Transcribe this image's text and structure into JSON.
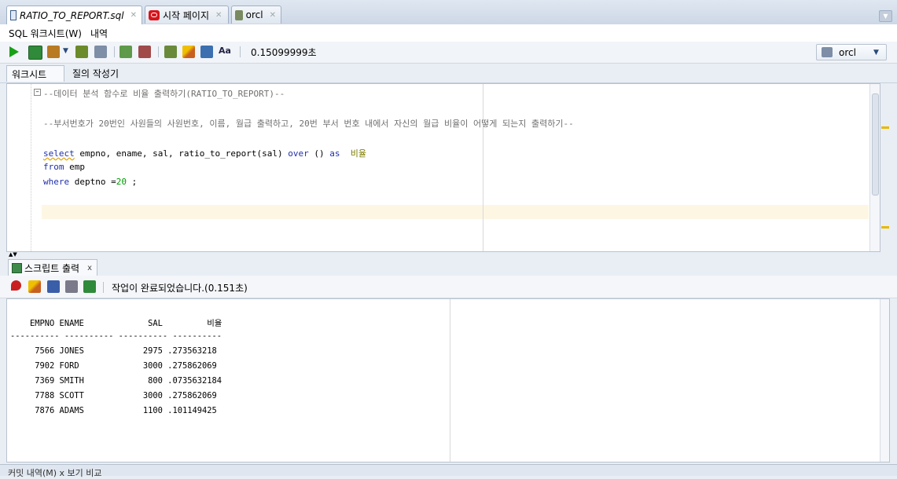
{
  "tabs": [
    {
      "label": "RATIO_TO_REPORT.sql",
      "icon": "sql-file-icon",
      "active": true
    },
    {
      "label": "시작 페이지",
      "icon": "oracle-icon",
      "active": false
    },
    {
      "label": "orcl",
      "icon": "sql-connection-icon",
      "active": false
    }
  ],
  "subtabs": {
    "worksheet": "SQL 워크시트(W)",
    "history": "내역"
  },
  "toolbar": {
    "exec_time": "0.15099999초",
    "connection": "orcl"
  },
  "worksheet_tabs": {
    "worksheet": "워크시트",
    "query_builder": "질의 작성기"
  },
  "editor": {
    "line1": "--데이터 분석 함수로 비율 출력하기(RATIO_TO_REPORT)--",
    "line2": "--부서번호가 20번인 사원들의 사원번호, 이름, 월급 출력하고, 20번 부서 번호 내에서 자신의 월급 비율이 어떻게 되는지 출력하기--",
    "select_kw": "select",
    "select_cols": " empno, ename, sal, ratio_to_report(sal) ",
    "over_kw": "over",
    "over_rest": " () ",
    "as_kw": "as",
    "alias": "비율",
    "from_kw": "from",
    "from_table": " emp",
    "where_kw": "where",
    "where_cond": " deptno =",
    "where_num": "20",
    "where_end": " ;"
  },
  "output": {
    "tab_label": "스크립트 출력",
    "tab_close": "x",
    "status": "작업이 완료되었습니다.(0.151초)",
    "header": "    EMPNO ENAME             SAL         비율",
    "divider": "---------- ---------- ---------- ----------",
    "rows": [
      "     7566 JONES            2975 .273563218",
      "     7902 FORD             3000 .275862069",
      "     7369 SMITH             800 .0735632184",
      "     7788 SCOTT            3000 .275862069",
      "     7876 ADAMS            1100 .101149425"
    ]
  },
  "bottom": {
    "tab_label": "커밋 내역(M) x   보기 비교"
  },
  "colors": {
    "keyword": "#1f2fa8",
    "comment": "#707070",
    "number": "#009900",
    "alias": "#7a7a00",
    "current_line": "#fdf6e3"
  }
}
